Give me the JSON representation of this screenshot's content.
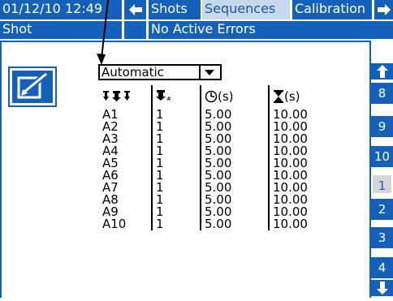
{
  "header": {
    "datetime": "01/12/10 12:49",
    "tab_shots": "Shots",
    "tab_sequences": "Sequences",
    "tab_calibration": "Calibration",
    "left_arrow": "◀",
    "right_arrow": "➡"
  },
  "status": {
    "mode": "Shot",
    "message": "No Active Errors"
  },
  "mode_select": {
    "value": "Automatic"
  },
  "table": {
    "headers": {
      "time_unit": "(s)",
      "duration_unit": "(s)"
    },
    "rows": [
      {
        "seq": "A1",
        "qty": "1",
        "time": "5.00",
        "duration": "10.00"
      },
      {
        "seq": "A2",
        "qty": "1",
        "time": "5.00",
        "duration": "10.00"
      },
      {
        "seq": "A3",
        "qty": "1",
        "time": "5.00",
        "duration": "10.00"
      },
      {
        "seq": "A4",
        "qty": "1",
        "time": "5.00",
        "duration": "10.00"
      },
      {
        "seq": "A5",
        "qty": "1",
        "time": "5.00",
        "duration": "10.00"
      },
      {
        "seq": "A6",
        "qty": "1",
        "time": "5.00",
        "duration": "10.00"
      },
      {
        "seq": "A7",
        "qty": "1",
        "time": "5.00",
        "duration": "10.00"
      },
      {
        "seq": "A8",
        "qty": "1",
        "time": "5.00",
        "duration": "10.00"
      },
      {
        "seq": "A9",
        "qty": "1",
        "time": "5.00",
        "duration": "10.00"
      },
      {
        "seq": "A10",
        "qty": "1",
        "time": "5.00",
        "duration": "10.00"
      }
    ]
  },
  "side_nav": {
    "items": [
      "8",
      "9",
      "10",
      "1",
      "2",
      "3",
      "4"
    ],
    "selected": "1"
  },
  "colors": {
    "accent": "#1560b8",
    "selected_tab": "#c8d8ec"
  }
}
